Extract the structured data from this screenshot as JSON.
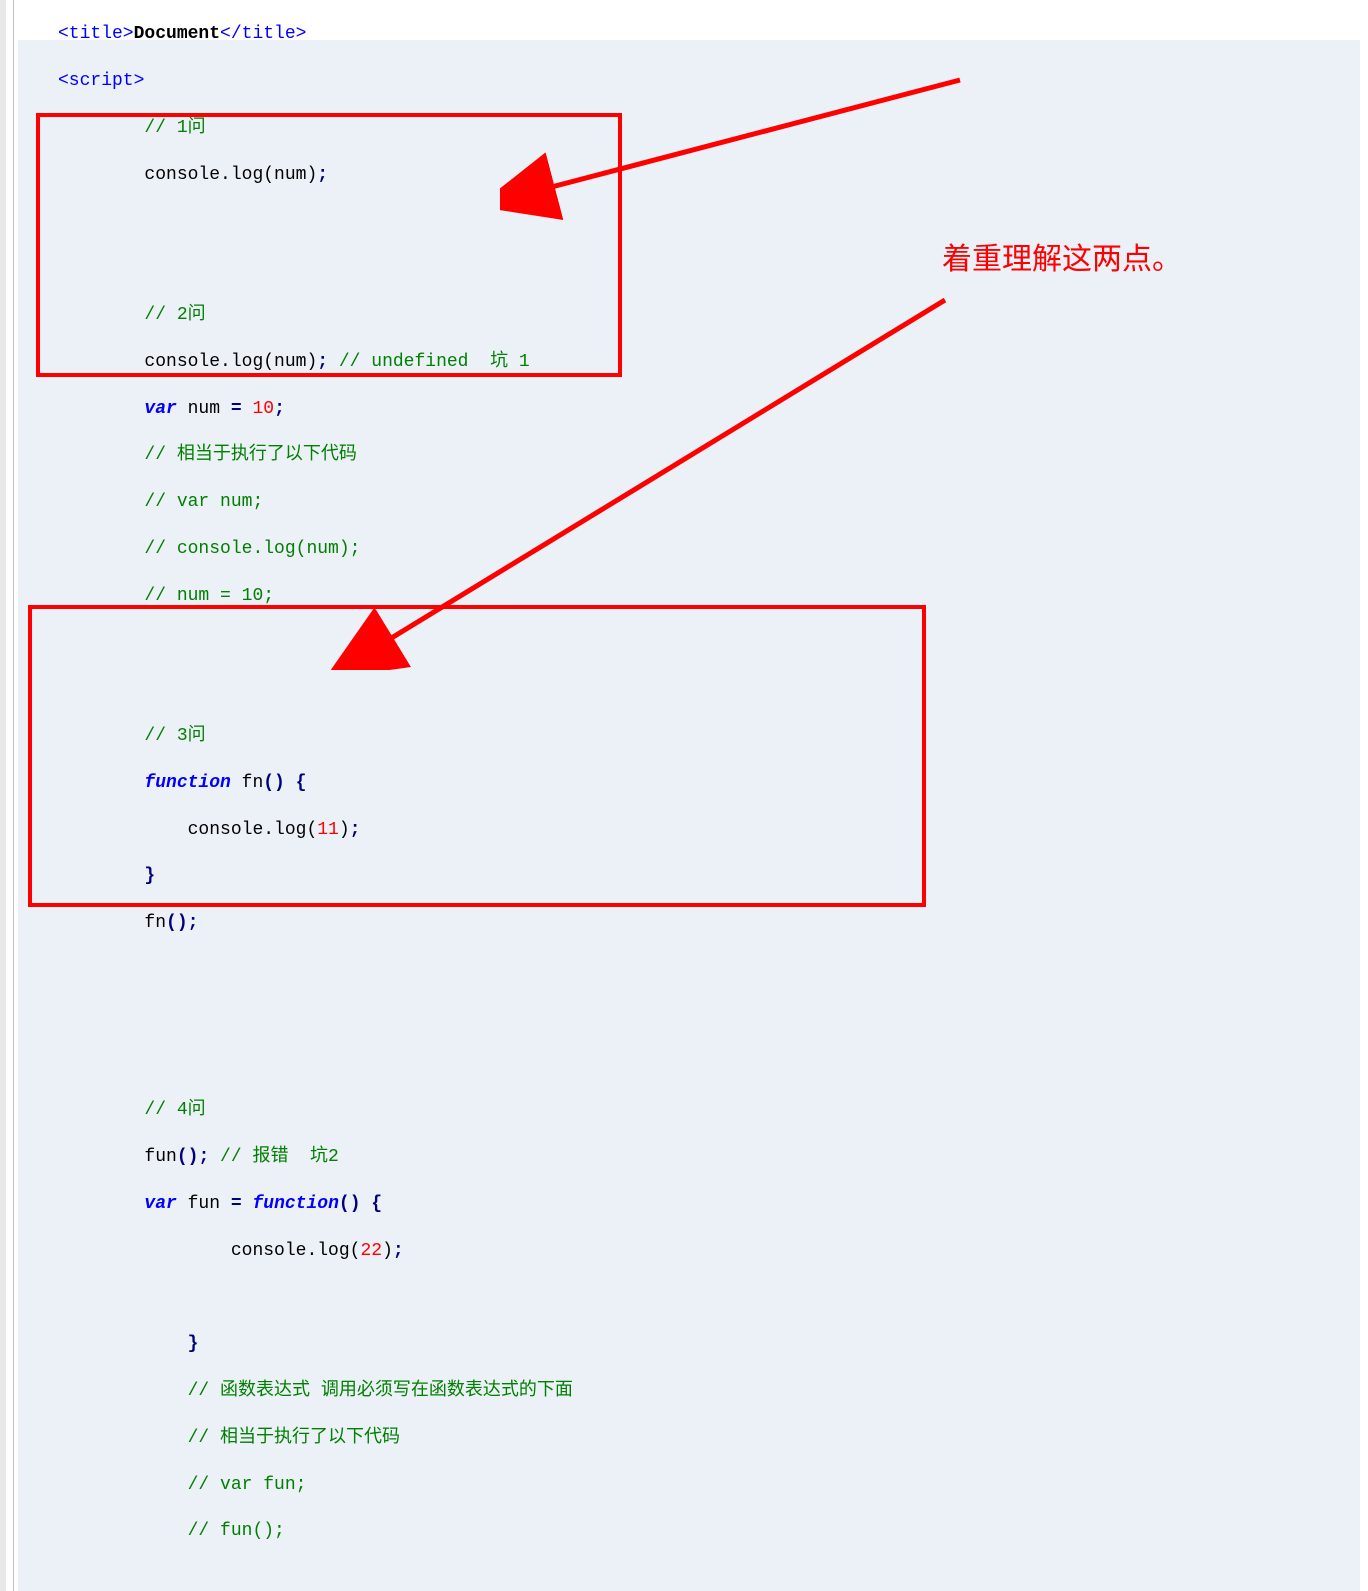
{
  "annotation": {
    "main_note": "着重理解这两点。"
  },
  "code": {
    "l1_a": "<title>",
    "l1_b": "Document",
    "l1_c": "</title>",
    "l2_a": "<script>",
    "l3": "// 1问",
    "l4_a": "console.log(num)",
    "l4_b": ";",
    "l5": "",
    "l6": "",
    "l7": "// 2问",
    "l8_a": "console.log(num)",
    "l8_b": ";",
    "l8_c": " // undefined  坑 1",
    "l9_a": "var",
    "l9_b": " num ",
    "l9_c": "=",
    "l9_d": " ",
    "l9_e": "10",
    "l9_f": ";",
    "l10": "// 相当于执行了以下代码",
    "l11": "// var num;",
    "l12": "// console.log(num);",
    "l13": "// num = 10;",
    "l14": "",
    "l15": "",
    "l16": "// 3问",
    "l17_a": "function",
    "l17_b": " fn",
    "l17_c": "()",
    "l17_d": " {",
    "l18_a": "    console.log(",
    "l18_b": "11",
    "l18_c": ")",
    "l18_d": ";",
    "l19": "}",
    "l20_a": "fn",
    "l20_b": "()",
    "l20_c": ";",
    "l21": "",
    "l22": "",
    "l23": "",
    "l24": "// 4问",
    "l25_a": "fun",
    "l25_b": "()",
    "l25_c": ";",
    "l25_d": " // 报错  坑2",
    "l26_a": "var",
    "l26_b": " fun ",
    "l26_c": "=",
    "l26_d": " ",
    "l26_e": "function",
    "l26_f": "()",
    "l26_g": " {",
    "l27_a": "        console.log(",
    "l27_b": "22",
    "l27_c": ")",
    "l27_d": ";",
    "l28": "",
    "l29": "    }",
    "l30": "    // 函数表达式 调用必须写在函数表达式的下面",
    "l31": "    // 相当于执行了以下代码",
    "l32": "    // var fun;",
    "l33": "    // fun();"
  }
}
